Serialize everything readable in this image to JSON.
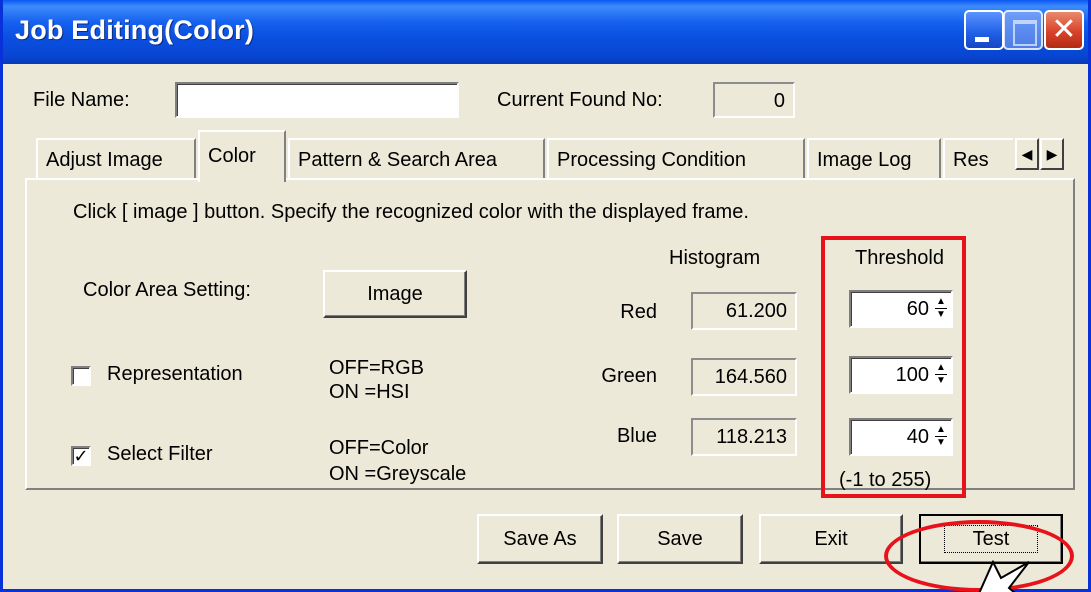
{
  "window": {
    "title": "Job Editing(Color)",
    "min_glyph": "",
    "max_glyph": "",
    "close_glyph": "✕"
  },
  "file": {
    "label": "File Name:",
    "value": "",
    "current_found_label": "Current Found No:",
    "current_found_value": "0"
  },
  "tabs": [
    {
      "label": "Adjust Image",
      "active": false
    },
    {
      "label": "Color",
      "active": true
    },
    {
      "label": "Pattern & Search Area",
      "active": false
    },
    {
      "label": "Processing Condition",
      "active": false
    },
    {
      "label": "Image Log",
      "active": false
    },
    {
      "label": "Res",
      "active": false
    }
  ],
  "tab_scroll": {
    "left": "◀",
    "right": "▶"
  },
  "color_tab": {
    "instruction": "Click [ image ] button.  Specify the recognized color with the displayed frame.",
    "histogram_header": "Histogram",
    "threshold_header": "Threshold",
    "color_area_label": "Color Area Setting:",
    "image_button": "Image",
    "representation": {
      "label": "Representation",
      "checked": false,
      "note1": "OFF=RGB",
      "note2": "ON =HSI"
    },
    "select_filter": {
      "label": "Select Filter",
      "checked": true,
      "note1": "OFF=Color",
      "note2": "ON =Greyscale"
    },
    "channels": [
      {
        "name": "Red",
        "histogram": "61.200",
        "threshold": "60"
      },
      {
        "name": "Green",
        "histogram": "164.560",
        "threshold": "100"
      },
      {
        "name": "Blue",
        "histogram": "118.213",
        "threshold": "40"
      }
    ],
    "range_note": "(-1 to 255)",
    "check_mark": "✓"
  },
  "buttons": {
    "save_as": "Save As",
    "save": "Save",
    "exit": "Exit",
    "test": "Test"
  },
  "annotation": {
    "highlight_color": "#e8121b"
  }
}
